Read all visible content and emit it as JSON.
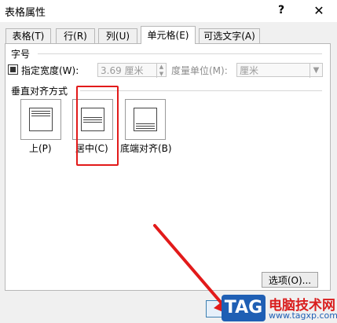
{
  "window": {
    "title": "表格属性",
    "help_label": "?",
    "close_label": "✕"
  },
  "tabs": [
    {
      "label": "表格(T)",
      "active": false
    },
    {
      "label": "行(R)",
      "active": false
    },
    {
      "label": "列(U)",
      "active": false
    },
    {
      "label": "单元格(E)",
      "active": true
    },
    {
      "label": "可选文字(A)",
      "active": false
    }
  ],
  "size_section": {
    "title": "字号",
    "preferred_width_checked": true,
    "preferred_width_label": "指定宽度(W):",
    "width_value": "3.69 厘米",
    "unit_label": "度量单位(M):",
    "unit_value": "厘米"
  },
  "valign_section": {
    "title": "垂直对齐方式",
    "options": [
      {
        "label": "上(P)",
        "selected": false
      },
      {
        "label": "居中(C)",
        "selected": true
      },
      {
        "label": "底端对齐(B)",
        "selected": false
      }
    ]
  },
  "options_button_label": "选项(O)...",
  "watermark": {
    "tag": "TAG",
    "text": "电脑技术网",
    "url": "www.tagxp.com"
  },
  "colors": {
    "highlight_red": "#e21a1a",
    "watermark_blue": "#1f5fb4"
  }
}
